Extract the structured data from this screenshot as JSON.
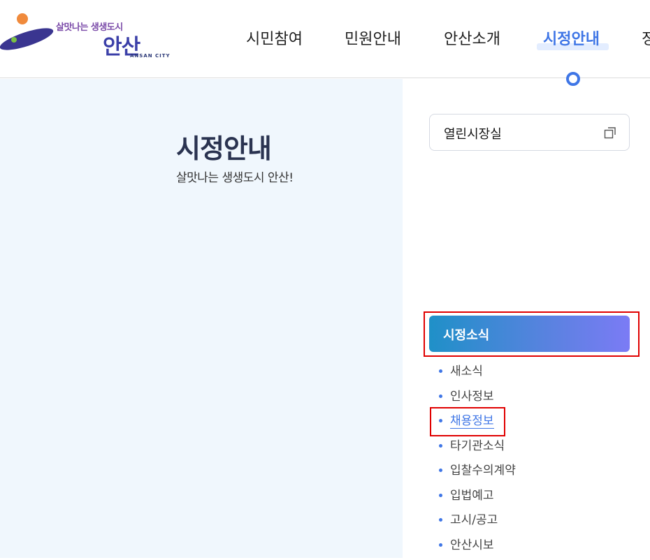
{
  "logo": {
    "slogan": "살맛나는 생생도시",
    "city": "안산",
    "city_en": "ANSAN CITY"
  },
  "gnb": {
    "items": [
      "시민참여",
      "민원안내",
      "안산소개",
      "시정안내",
      "정"
    ],
    "active": "시정안내"
  },
  "page": {
    "title": "시정안내",
    "subtitle": "살맛나는 생생도시 안산!"
  },
  "sidebar": {
    "mayor_office": "열린시장실",
    "section": "시정소식",
    "items": [
      "새소식",
      "인사정보",
      "채용정보",
      "타기관소식",
      "입찰수의계약",
      "입법예고",
      "고시/공고",
      "안산시보"
    ],
    "active_item": "채용정보"
  },
  "colors": {
    "accent": "#3f76e6",
    "left_panel_bg": "#f0f7fd",
    "highlight": "#e00000",
    "gradient_start": "#1f90c8",
    "gradient_end": "#7b7bf5"
  }
}
